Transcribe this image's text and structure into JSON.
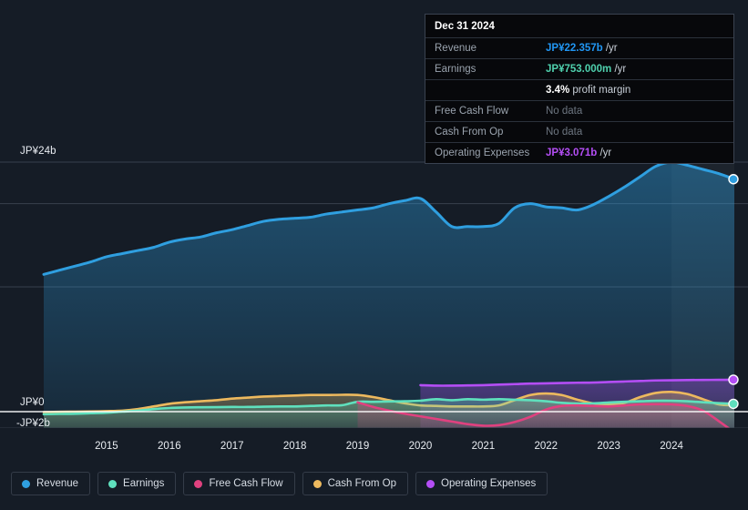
{
  "tooltip": {
    "title": "Dec 31 2024",
    "rows": [
      {
        "key": "Revenue",
        "value": "JP¥22.357b",
        "unit": " /yr",
        "color": "#2196f3",
        "nodata": false
      },
      {
        "key": "Earnings",
        "value": "JP¥753.000m",
        "unit": " /yr",
        "color": "#4fd1ae",
        "nodata": false
      },
      {
        "key": "",
        "value": "3.4%",
        "unit": " profit margin",
        "color": "#ffffff",
        "nodata": false
      },
      {
        "key": "Free Cash Flow",
        "value": "No data",
        "unit": "",
        "color": "#6d7681",
        "nodata": true
      },
      {
        "key": "Cash From Op",
        "value": "No data",
        "unit": "",
        "color": "#6d7681",
        "nodata": true
      },
      {
        "key": "Operating Expenses",
        "value": "JP¥3.071b",
        "unit": " /yr",
        "color": "#b44ef5",
        "nodata": false
      }
    ]
  },
  "legend": [
    {
      "label": "Revenue",
      "color": "#2f9fe0"
    },
    {
      "label": "Earnings",
      "color": "#5fe0bd"
    },
    {
      "label": "Free Cash Flow",
      "color": "#e0417f"
    },
    {
      "label": "Cash From Op",
      "color": "#edb95e"
    },
    {
      "label": "Operating Expenses",
      "color": "#b44ef5"
    }
  ],
  "axes": {
    "y_top_label": "JP¥24b",
    "y_zero_label": "JP¥0",
    "y_bottom_label": "-JP¥2b",
    "x_labels": [
      "2015",
      "2016",
      "2017",
      "2018",
      "2019",
      "2020",
      "2021",
      "2022",
      "2023",
      "2024"
    ]
  },
  "chart_data": {
    "type": "area",
    "title": "",
    "xlabel": "",
    "ylabel": "JP¥",
    "ylim": [
      -2,
      24
    ],
    "yticks": [
      24,
      0,
      -2
    ],
    "ytick_labels": [
      "JP¥24b",
      "JP¥0",
      "-JP¥2b"
    ],
    "grid": true,
    "legend_position": "bottom",
    "currency": "JP¥",
    "units": "billions",
    "x": [
      2014.0,
      2014.25,
      2014.5,
      2014.75,
      2015.0,
      2015.25,
      2015.5,
      2015.75,
      2016.0,
      2016.25,
      2016.5,
      2016.75,
      2017.0,
      2017.25,
      2017.5,
      2017.75,
      2018.0,
      2018.25,
      2018.5,
      2018.75,
      2019.0,
      2019.25,
      2019.5,
      2019.75,
      2020.0,
      2020.25,
      2020.5,
      2020.75,
      2021.0,
      2021.25,
      2021.5,
      2021.75,
      2022.0,
      2022.25,
      2022.5,
      2022.75,
      2023.0,
      2023.25,
      2023.5,
      2023.75,
      2024.0,
      2024.25,
      2024.5,
      2024.75,
      2025.0
    ],
    "highlight_band": {
      "from": 2024.0,
      "to": 2025.0
    },
    "series": [
      {
        "name": "Revenue",
        "color": "#2f9fe0",
        "fill": "rgba(33,110,160,0.45)",
        "end_marker": true,
        "end_value": 22.357,
        "values": [
          13.2,
          13.6,
          14.0,
          14.4,
          14.9,
          15.2,
          15.5,
          15.8,
          16.3,
          16.6,
          16.8,
          17.2,
          17.5,
          17.9,
          18.3,
          18.5,
          18.6,
          18.7,
          19.0,
          19.2,
          19.4,
          19.6,
          20.0,
          20.3,
          20.5,
          19.2,
          17.8,
          17.8,
          17.8,
          18.1,
          19.6,
          20.0,
          19.7,
          19.6,
          19.4,
          19.9,
          20.7,
          21.6,
          22.6,
          23.6,
          24.0,
          23.7,
          23.3,
          22.9,
          22.357
        ]
      },
      {
        "name": "Earnings",
        "color": "#5fe0bd",
        "fill": "rgba(70,160,140,0.30)",
        "end_marker": true,
        "end_value": 0.753,
        "values": [
          -0.25,
          -0.22,
          -0.2,
          -0.15,
          -0.1,
          0.0,
          0.1,
          0.25,
          0.35,
          0.4,
          0.42,
          0.43,
          0.45,
          0.45,
          0.48,
          0.5,
          0.5,
          0.55,
          0.6,
          0.62,
          0.95,
          0.95,
          0.98,
          1.0,
          1.05,
          1.2,
          1.1,
          1.2,
          1.15,
          1.2,
          1.15,
          1.1,
          1.0,
          0.85,
          0.78,
          0.8,
          0.88,
          0.95,
          1.0,
          1.05,
          1.05,
          1.0,
          0.9,
          0.82,
          0.753
        ]
      },
      {
        "name": "Free Cash Flow",
        "color": "#e0417f",
        "fill": "rgba(180,50,95,0.25)",
        "start_x": 2019.0,
        "end_marker": false,
        "values": [
          null,
          null,
          null,
          null,
          null,
          null,
          null,
          null,
          null,
          null,
          null,
          null,
          null,
          null,
          null,
          null,
          null,
          null,
          null,
          null,
          0.9,
          0.45,
          0.1,
          -0.2,
          -0.45,
          -0.7,
          -0.95,
          -1.2,
          -1.35,
          -1.3,
          -1.0,
          -0.5,
          0.2,
          0.55,
          0.6,
          0.55,
          0.5,
          0.6,
          0.7,
          0.72,
          0.7,
          0.55,
          0.1,
          -0.9,
          -2.0
        ]
      },
      {
        "name": "Cash From Op",
        "color": "#edb95e",
        "fill": "rgba(150,130,70,0.30)",
        "end_marker": false,
        "values": [
          -0.05,
          -0.02,
          0.0,
          0.02,
          0.05,
          0.1,
          0.25,
          0.5,
          0.75,
          0.9,
          1.0,
          1.1,
          1.25,
          1.35,
          1.45,
          1.5,
          1.55,
          1.6,
          1.6,
          1.62,
          1.6,
          1.4,
          1.1,
          0.8,
          0.6,
          0.55,
          0.5,
          0.5,
          0.5,
          0.6,
          1.1,
          1.6,
          1.75,
          1.6,
          1.15,
          0.8,
          0.7,
          0.85,
          1.4,
          1.8,
          1.9,
          1.7,
          1.2,
          0.7,
          0.6
        ]
      },
      {
        "name": "Operating Expenses",
        "color": "#b44ef5",
        "fill": "rgba(110,55,170,0.28)",
        "start_x": 2020.0,
        "end_marker": true,
        "end_value": 3.071,
        "values": [
          null,
          null,
          null,
          null,
          null,
          null,
          null,
          null,
          null,
          null,
          null,
          null,
          null,
          null,
          null,
          null,
          null,
          null,
          null,
          null,
          null,
          null,
          null,
          null,
          2.55,
          2.5,
          2.5,
          2.52,
          2.55,
          2.6,
          2.65,
          2.7,
          2.72,
          2.75,
          2.78,
          2.8,
          2.85,
          2.9,
          2.95,
          3.0,
          3.02,
          3.04,
          3.05,
          3.06,
          3.071
        ]
      }
    ]
  }
}
